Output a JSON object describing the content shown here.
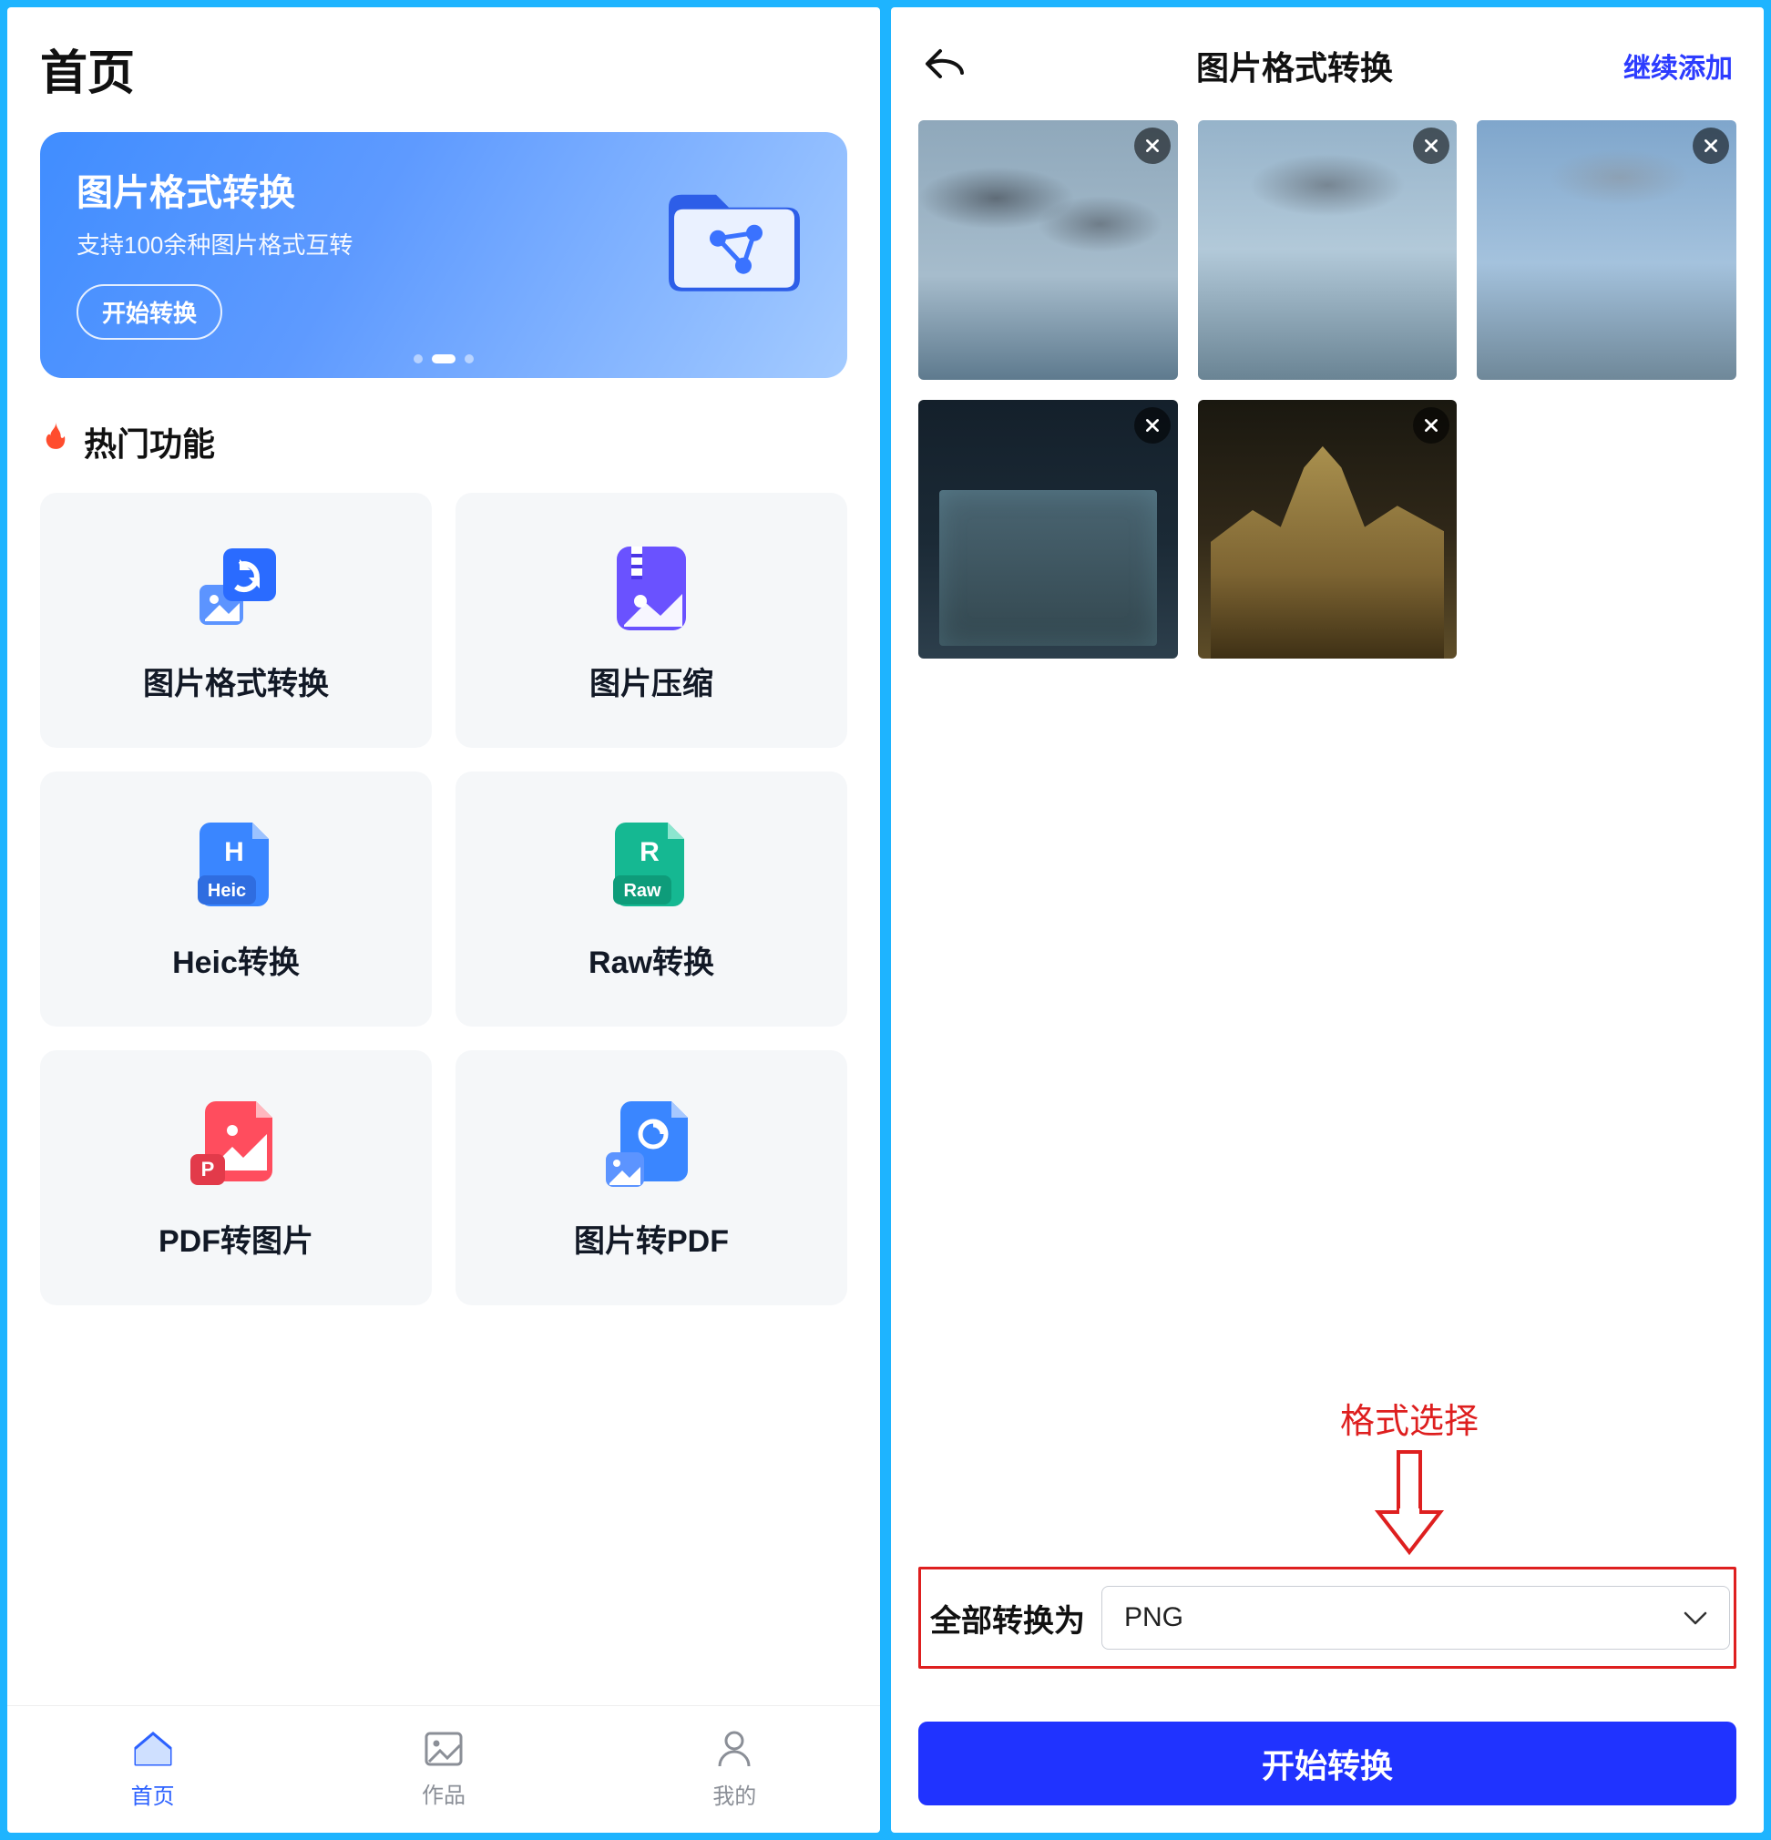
{
  "left": {
    "title": "首页",
    "banner": {
      "title": "图片格式转换",
      "subtitle": "支持100余种图片格式互转",
      "cta": "开始转换"
    },
    "section_title": "热门功能",
    "features": [
      {
        "label": "图片格式转换",
        "icon": "convert"
      },
      {
        "label": "图片压缩",
        "icon": "compress"
      },
      {
        "label": "Heic转换",
        "icon": "heic"
      },
      {
        "label": "Raw转换",
        "icon": "raw"
      },
      {
        "label": "PDF转图片",
        "icon": "pdf2img"
      },
      {
        "label": "图片转PDF",
        "icon": "img2pdf"
      }
    ],
    "nav": {
      "home": "首页",
      "works": "作品",
      "mine": "我的"
    }
  },
  "right": {
    "title": "图片格式转换",
    "add_more": "继续添加",
    "thumbs": [
      "sky1",
      "sky2",
      "sky3",
      "night1",
      "night2"
    ],
    "callout": "格式选择",
    "convert_all_label": "全部转换为",
    "selected_format": "PNG",
    "start": "开始转换"
  }
}
